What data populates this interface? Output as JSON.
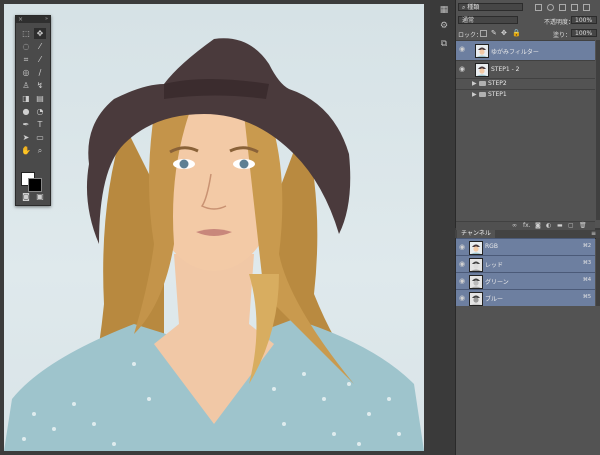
{
  "toolbox": {
    "close": "×",
    "grip": "»"
  },
  "layers_panel": {
    "kind_filter": "種類",
    "blend_mode": "通常",
    "opacity_label": "不透明度：",
    "opacity_value": "100%",
    "lock_label": "ロック：",
    "fill_label": "塗り：",
    "fill_value": "100%",
    "layers": [
      {
        "name": "ゆがみフィルター",
        "selected": true
      },
      {
        "name": "STEP1 - 2",
        "selected": false
      },
      {
        "name": "STEP2",
        "group": true
      },
      {
        "name": "STEP1",
        "group": true
      }
    ],
    "footer_icons": [
      "link-icon",
      "fx-icon",
      "mask-icon",
      "adjustment-icon",
      "folder-icon",
      "new-layer-icon",
      "trash-icon"
    ],
    "fx": "fx."
  },
  "channels_panel": {
    "tab": "チャンネル",
    "channels": [
      {
        "name": "RGB",
        "shortcut": "⌘2"
      },
      {
        "name": "レッド",
        "shortcut": "⌘3"
      },
      {
        "name": "グリーン",
        "shortcut": "⌘4"
      },
      {
        "name": "ブルー",
        "shortcut": "⌘5"
      }
    ]
  },
  "colors": {
    "selection": "#6d7fa0",
    "panel": "#535353",
    "background": "#3a3a3a"
  }
}
